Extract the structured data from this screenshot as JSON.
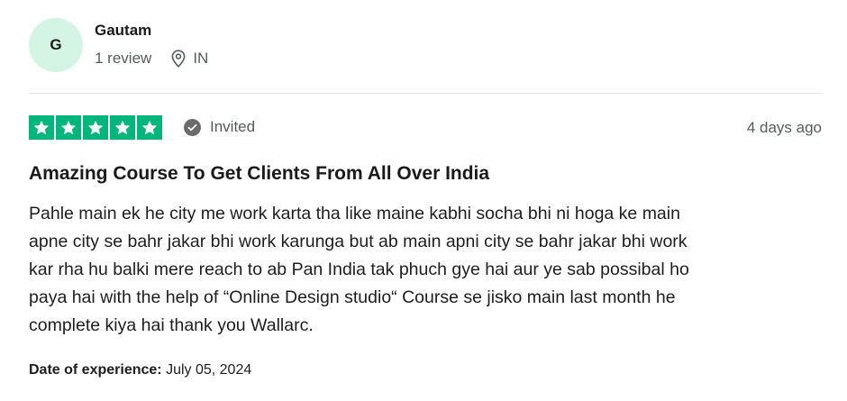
{
  "reviewer": {
    "initial": "G",
    "name": "Gautam",
    "review_count": "1 review",
    "country": "IN",
    "location_icon": "map-pin-icon",
    "avatar_color": "#d4f5e4"
  },
  "rating": {
    "stars": 5,
    "max_stars": 5,
    "star_color": "#00b67a",
    "star_icon": "star-icon"
  },
  "status": {
    "label": "Invited",
    "icon": "check-circle-icon"
  },
  "posted": "4 days ago",
  "review": {
    "title": "Amazing Course To Get Clients From All Over India",
    "lines": [
      "Pahle main ek he city me work karta tha like maine kabhi socha bhi ni hoga ke main",
      "apne city se bahr jakar bhi work karunga but ab main apni city se bahr jakar bhi work",
      "kar rha hu balki mere reach to ab Pan India tak phuch gye hai aur ye sab possibal ho",
      "paya hai with the help of “Online Design studio“ Course se jisko main last month he",
      "complete kiya hai thank you Wallarc."
    ]
  },
  "experience": {
    "label": "Date of experience:",
    "date": "July 05, 2024"
  }
}
